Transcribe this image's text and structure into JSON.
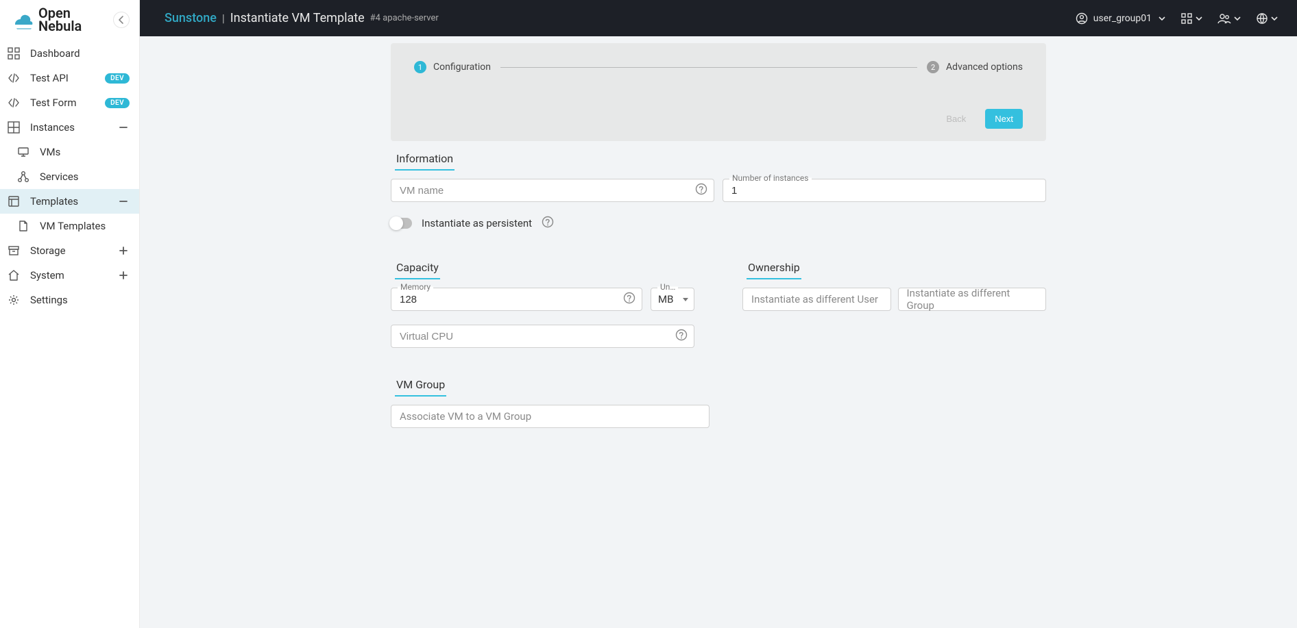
{
  "brand": {
    "name": "Open",
    "name2": "Nebula"
  },
  "sidebar": {
    "items": [
      {
        "label": "Dashboard"
      },
      {
        "label": "Test API",
        "badge": "DEV"
      },
      {
        "label": "Test Form",
        "badge": "DEV"
      },
      {
        "label": "Instances",
        "expand": "minus"
      },
      {
        "label": "VMs",
        "sub": true
      },
      {
        "label": "Services",
        "sub": true
      },
      {
        "label": "Templates",
        "expand": "minus",
        "active": true
      },
      {
        "label": "VM Templates",
        "sub": true
      },
      {
        "label": "Storage",
        "expand": "plus"
      },
      {
        "label": "System",
        "expand": "plus"
      },
      {
        "label": "Settings"
      }
    ]
  },
  "header": {
    "app": "Sunstone",
    "title": "Instantiate VM Template",
    "template_id": "#4 apache-server",
    "user": "user_group01"
  },
  "stepper": {
    "steps": [
      {
        "num": "1",
        "label": "Configuration"
      },
      {
        "num": "2",
        "label": "Advanced options"
      }
    ],
    "back": "Back",
    "next": "Next"
  },
  "sections": {
    "info": {
      "title": "Information",
      "vmname_ph": "VM name",
      "instances_label": "Number of instances",
      "instances_value": "1",
      "persistent_label": "Instantiate as persistent"
    },
    "capacity": {
      "title": "Capacity",
      "memory_label": "Memory",
      "memory_value": "128",
      "unit_label": "Un…",
      "unit_value": "MB",
      "vcpu_ph": "Virtual CPU"
    },
    "ownership": {
      "title": "Ownership",
      "user_ph": "Instantiate as different User",
      "group_ph": "Instantiate as different Group"
    },
    "vmgroup": {
      "title": "VM Group",
      "select_ph": "Associate VM to a VM Group"
    }
  }
}
